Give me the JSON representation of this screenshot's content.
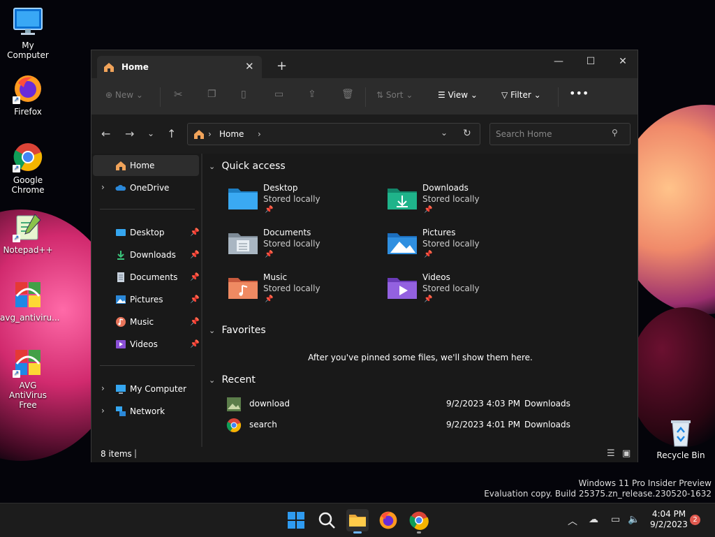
{
  "desktop": {
    "icons": [
      {
        "label": "My Computer"
      },
      {
        "label": "Firefox"
      },
      {
        "label": "Google Chrome"
      },
      {
        "label": "Notepad++"
      },
      {
        "label": "avg_antiviru..."
      },
      {
        "label": "AVG AntiVirus Free"
      },
      {
        "label": "Recycle Bin"
      }
    ],
    "watermark_line1": "Windows 11 Pro Insider Preview",
    "watermark_line2": "Evaluation copy. Build 25375.zn_release.230520-1632"
  },
  "window": {
    "tab_title": "Home",
    "commands": {
      "new": "New",
      "sort": "Sort",
      "view": "View",
      "filter": "Filter"
    },
    "breadcrumb": "Home",
    "search_placeholder": "Search Home",
    "sidebar": {
      "home": "Home",
      "onedrive": "OneDrive",
      "pinned": [
        "Desktop",
        "Downloads",
        "Documents",
        "Pictures",
        "Music",
        "Videos"
      ],
      "my_computer": "My Computer",
      "network": "Network"
    },
    "sections": {
      "quick_access": "Quick access",
      "favorites": "Favorites",
      "recent": "Recent"
    },
    "quick_access": [
      {
        "name": "Desktop",
        "sub": "Stored locally"
      },
      {
        "name": "Downloads",
        "sub": "Stored locally"
      },
      {
        "name": "Documents",
        "sub": "Stored locally"
      },
      {
        "name": "Pictures",
        "sub": "Stored locally"
      },
      {
        "name": "Music",
        "sub": "Stored locally"
      },
      {
        "name": "Videos",
        "sub": "Stored locally"
      }
    ],
    "favorites_empty": "After you've pinned some files, we'll show them here.",
    "recent": [
      {
        "name": "download",
        "date": "9/2/2023 4:03 PM",
        "location": "Downloads"
      },
      {
        "name": "search",
        "date": "9/2/2023 4:01 PM",
        "location": "Downloads"
      }
    ],
    "status_items": "8 items"
  },
  "taskbar": {
    "time": "4:04 PM",
    "date": "9/2/2023",
    "notification_count": "2"
  }
}
